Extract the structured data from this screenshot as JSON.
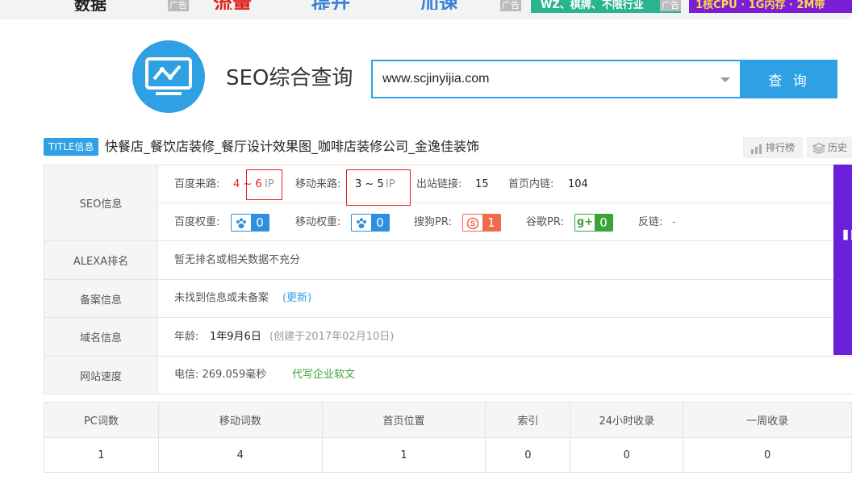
{
  "ads": {
    "ad1_text": "数据",
    "ad1_tag": "广告",
    "ad2_text": "流量",
    "ad3_text": "提升",
    "ad4_text": "加速",
    "ad4_tag": "广告",
    "ad5_text": "WZ、棋牌、不限行业",
    "ad5_tag": "广告",
    "ad6_text": "1核CPU · 1G内存 · 2M带"
  },
  "header": {
    "title": "SEO综合查询",
    "search_value": "www.scjinyijia.com",
    "search_button": "查 询"
  },
  "title_row": {
    "badge": "TITLE信息",
    "text": "快餐店_餐饮店装修_餐厅设计效果图_咖啡店装修公司_金逸佳装饰",
    "rank_label": "排行榜",
    "history_label": "历史"
  },
  "seo": {
    "label": "SEO信息",
    "baidu_source_label": "百度来路:",
    "baidu_source_value": "4 ~ 6",
    "mobile_source_label": "移动来路:",
    "mobile_source_value": "3 ~ 5",
    "ip_unit": "IP",
    "outbound_label": "出站链接:",
    "outbound_value": "15",
    "internal_label": "首页内链:",
    "internal_value": "104",
    "baidu_weight_label": "百度权重:",
    "baidu_weight_value": "0",
    "mobile_weight_label": "移动权重:",
    "mobile_weight_value": "0",
    "sogou_pr_label": "搜狗PR:",
    "sogou_pr_value": "1",
    "google_pr_label": "谷歌PR:",
    "google_pr_value": "0",
    "backlinks_label": "反链:",
    "backlinks_value": "-"
  },
  "alexa": {
    "label": "ALEXA排名",
    "value": "暂无排名或相关数据不充分"
  },
  "icp": {
    "label": "备案信息",
    "value": "未找到信息或未备案",
    "update_link": "(更新)"
  },
  "domain": {
    "label": "域名信息",
    "age_label": "年龄:",
    "age_value": "1年9月6日",
    "created": "(创建于2017年02月10日)"
  },
  "speed": {
    "label": "网站速度",
    "value": "电信: 269.059毫秒",
    "ad_link": "代写企业软文"
  },
  "stats": {
    "headers": [
      "PC词数",
      "移动词数",
      "首页位置",
      "索引",
      "24小时收录",
      "一周收录"
    ],
    "values": [
      "1",
      "4",
      "1",
      "0",
      "0",
      "0"
    ]
  },
  "colors": {
    "accent": "#2ea0e3",
    "red": "#e02020",
    "green": "#3aa33a",
    "purple": "#6a20d8"
  }
}
